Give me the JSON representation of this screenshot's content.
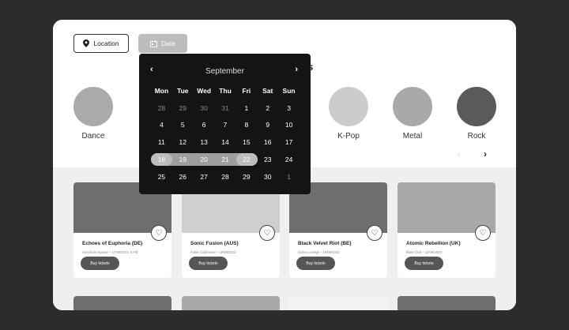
{
  "filters": {
    "location_label": "Location",
    "date_label": "Date"
  },
  "heading": "s",
  "genres": [
    {
      "label": "Dance",
      "color": "#aaaaaa"
    },
    {
      "label": "K-Pop",
      "color": "#cccccc"
    },
    {
      "label": "Metal",
      "color": "#a9a9a9"
    },
    {
      "label": "Rock",
      "color": "#5a5a5a"
    }
  ],
  "carousel": {
    "prev": "‹",
    "next": "›"
  },
  "calendar": {
    "month": "September",
    "weekdays": [
      "Mon",
      "Tue",
      "Wed",
      "Thu",
      "Fri",
      "Sat",
      "Sun"
    ],
    "weeks": [
      [
        "28",
        "29",
        "30",
        "31",
        "1",
        "2",
        "3"
      ],
      [
        "4",
        "5",
        "6",
        "7",
        "8",
        "9",
        "10"
      ],
      [
        "11",
        "12",
        "13",
        "14",
        "15",
        "16",
        "17"
      ],
      [
        "18",
        "19",
        "20",
        "21",
        "22",
        "23",
        "24"
      ],
      [
        "25",
        "26",
        "27",
        "28",
        "29",
        "30",
        "1"
      ]
    ],
    "selected_range": {
      "start": "18",
      "end": "22"
    }
  },
  "events": [
    {
      "title": "Echoes of Euphoria (DE)",
      "subtitle": "Sonorodo Square – 17/09/2023, 6 PM",
      "buy": "Buy tickets",
      "img_color": "#6e6e6e"
    },
    {
      "title": "Sonic Fusion (AUS)",
      "subtitle": "Pulse Clubhouse – 19/09/2023",
      "buy": "Buy tickets",
      "img_color": "#cfcfcf"
    },
    {
      "title": "Black Velvet Riot (BE)",
      "subtitle": "Vortex Lounge – 19/09/2023",
      "buy": "Buy tickets",
      "img_color": "#6e6e6e"
    },
    {
      "title": "Atomic Rebellion (UK)",
      "subtitle": "Blast Club – 22/09/2023",
      "buy": "Buy tickets",
      "img_color": "#a8a8a8"
    }
  ],
  "stub_colors": [
    "#6e6e6e",
    "#a9a9a9",
    "#f2f2f2",
    "#6e6e6e"
  ]
}
